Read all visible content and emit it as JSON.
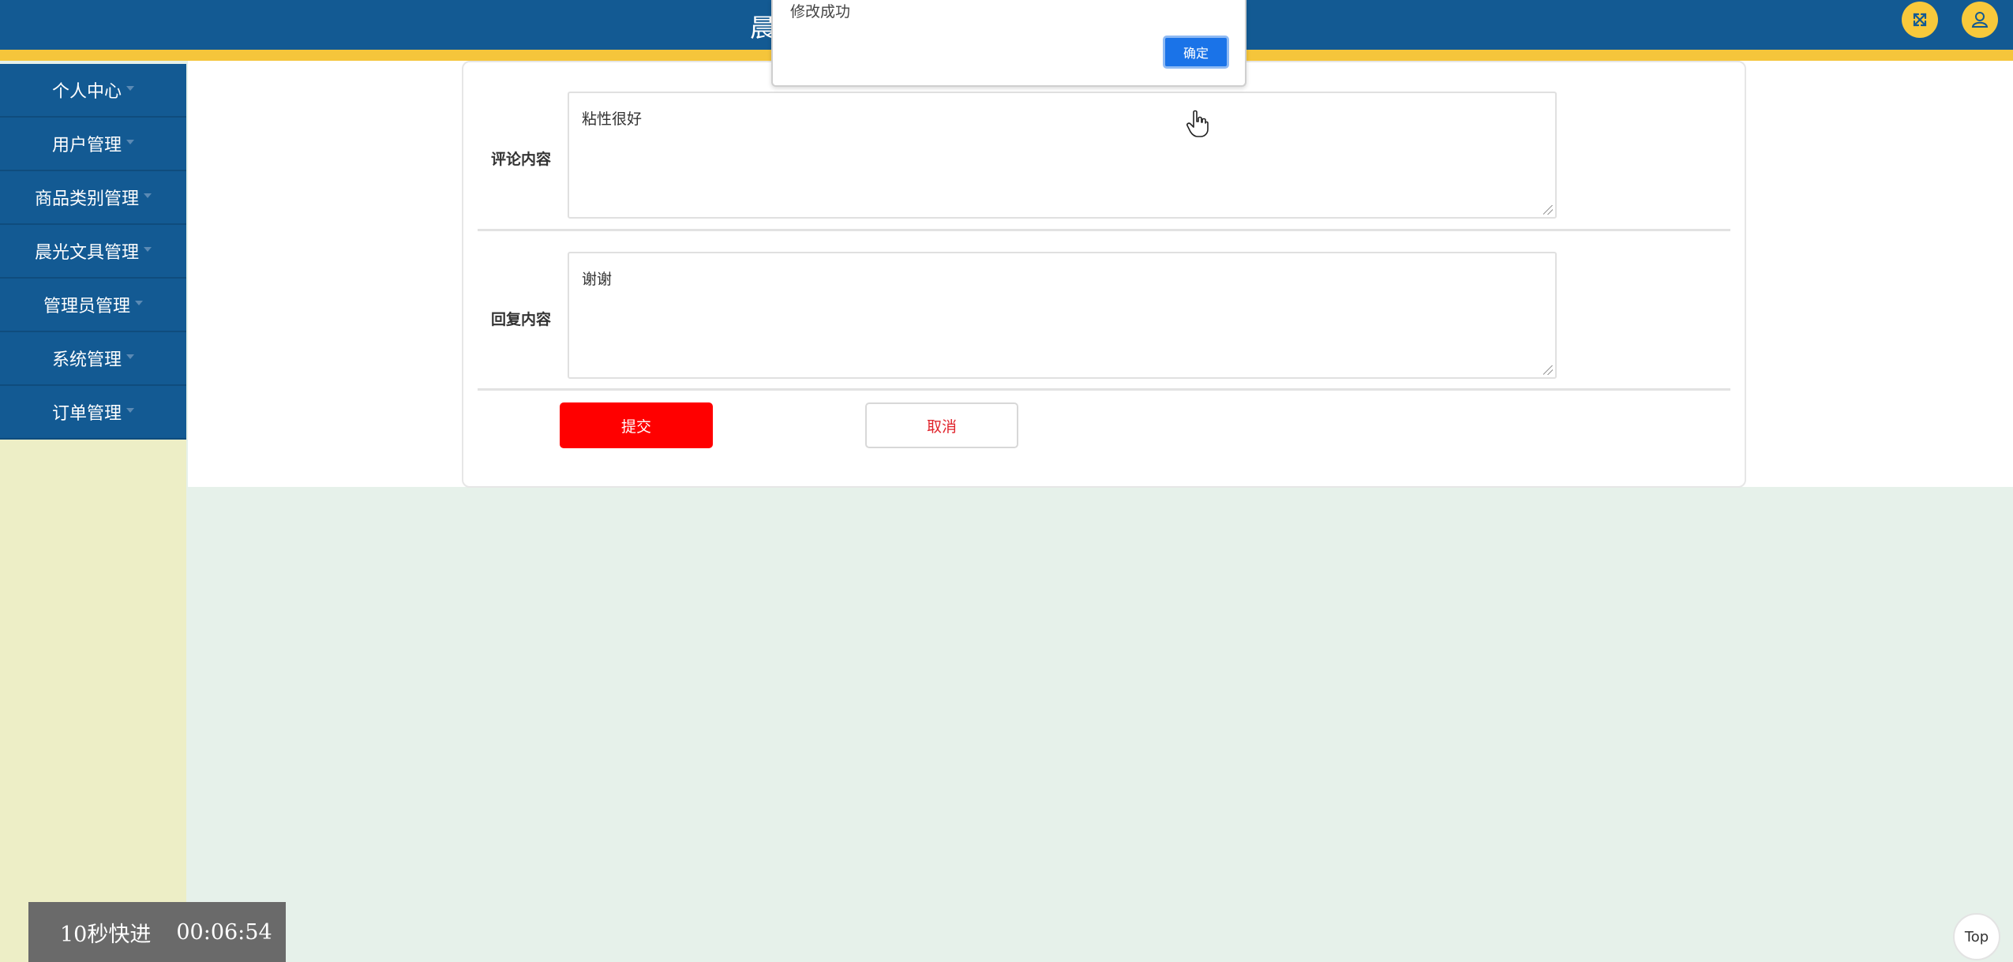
{
  "header": {
    "title": "晨",
    "fullscreen_icon": "expand-arrows-icon",
    "user_icon": "user-icon"
  },
  "sidebar": {
    "items": [
      {
        "label": "个人中心"
      },
      {
        "label": "用户管理"
      },
      {
        "label": "商品类别管理"
      },
      {
        "label": "晨光文具管理"
      },
      {
        "label": "管理员管理"
      },
      {
        "label": "系统管理"
      },
      {
        "label": "订单管理"
      }
    ]
  },
  "form": {
    "comment_label": "评论内容",
    "comment_value": "粘性很好",
    "reply_label": "回复内容",
    "reply_value": "谢谢",
    "submit_label": "提交",
    "cancel_label": "取消"
  },
  "dialog": {
    "message": "修改成功",
    "ok_label": "确定"
  },
  "video": {
    "skip_label": "10秒快进",
    "time": "00:06:54"
  },
  "top_button": {
    "label": "Top"
  },
  "colors": {
    "header_bg": "#135a93",
    "accent_stripe": "#f5c53b",
    "submit_bg": "#ff0000",
    "dialog_button": "#1a73e8",
    "sidebar_bg": "#edeec6",
    "page_bg": "#e6f1ea"
  }
}
